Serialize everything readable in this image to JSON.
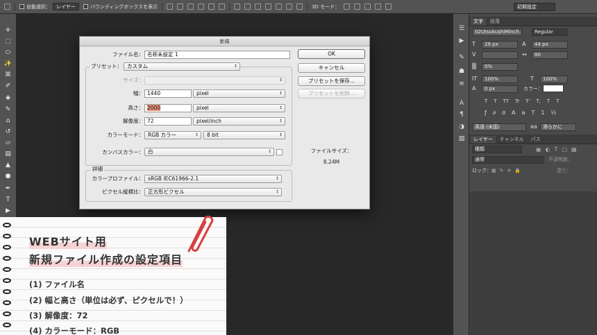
{
  "options_bar": {
    "auto_select_label": "自動選択：",
    "auto_select_value": "レイヤー",
    "bounding_box_label": "バウンディングボックスを表示",
    "mode_3d_label": "3D モード：",
    "workspace": "初期設定"
  },
  "dialog": {
    "title": "新規",
    "name_label": "ファイル名：",
    "name_value": "名称未設定 1",
    "preset_label": "プリセット：",
    "preset_value": "カスタム",
    "size_label": "サイズ：",
    "width_label": "幅：",
    "width_value": "1440",
    "width_unit": "pixel",
    "height_label": "高さ：",
    "height_value": "2000",
    "height_unit": "pixel",
    "resolution_label": "解像度：",
    "resolution_value": "72",
    "resolution_unit": "pixel/inch",
    "color_mode_label": "カラーモード：",
    "color_mode_value": "RGB カラー",
    "bit_depth": "8 bit",
    "background_label": "カンバスカラー：",
    "background_value": "白",
    "advanced_label": "詳細",
    "profile_label": "カラープロファイル：",
    "profile_value": "sRGB IEC61966-2.1",
    "pixel_aspect_label": "ピクセル縦横比：",
    "pixel_aspect_value": "正方形ピクセル",
    "ok_label": "OK",
    "cancel_label": "キャンセル",
    "save_preset_label": "プリセットを保存...",
    "delete_preset_label": "プリセットを削除...",
    "file_size_label": "ファイルサイズ：",
    "file_size_value": "8.24M"
  },
  "character_panel": {
    "tab_character": "文字",
    "tab_paragraph": "段落",
    "font_family": "02UtsukushiMinch...",
    "font_style": "Regular",
    "font_size": "29 px",
    "leading": "44 px",
    "tracking": "80",
    "tsume": "0%",
    "vertical_scale": "100%",
    "horizontal_scale": "100%",
    "baseline_shift": "0 px",
    "color_label": "カラー：",
    "language": "英語 (米国)",
    "anti_alias": "滑らかに",
    "style_buttons": [
      "T",
      "T",
      "TT",
      "Tr",
      "T'",
      "T,",
      "T",
      "T"
    ]
  },
  "layers_panel": {
    "tab_layers": "レイヤー",
    "tab_channels": "チャンネル",
    "tab_paths": "パス",
    "filter_label": "種類",
    "blend_mode": "通常",
    "opacity_label": "不透明度：",
    "lock_label": "ロック：",
    "fill_label": "塗り："
  },
  "notebook": {
    "heading_1": "WEBサイト用",
    "heading_2": "新規ファイル作成の設定項目",
    "items": [
      "(1) ファイル名",
      "(2) 幅と高さ（単位は必ず、ピクセルで！）",
      "(3) 解像度：72",
      "(4) カラーモード：RGB"
    ]
  },
  "colors": {
    "toolbar": "#535353",
    "workspace": "#282828",
    "dialog": "#e9e9e9",
    "highlight": "#e8927a",
    "paperclip": "#d64040"
  }
}
